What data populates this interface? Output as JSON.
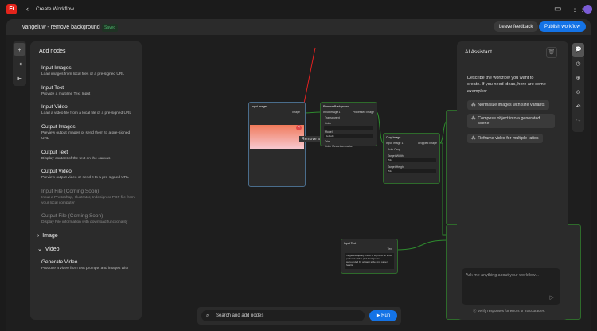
{
  "app": {
    "logo": "Fi",
    "back_title": "Create Workflow"
  },
  "header": {
    "workflow_name": "vangeluw - remove background",
    "status": "Saved",
    "feedback": "Leave feedback",
    "publish": "Publish workflow"
  },
  "panel": {
    "title": "Add nodes",
    "items": [
      {
        "name": "Input Images",
        "desc": "Load images from local files or a pre-signed URL"
      },
      {
        "name": "Input Text",
        "desc": "Provide a multiline Text Input"
      },
      {
        "name": "Input Video",
        "desc": "Load a video file from a local file or a pre-signed URL"
      },
      {
        "name": "Output Images",
        "desc": "Preview output images or send them to a pre-signed URL"
      },
      {
        "name": "Output Text",
        "desc": "Display content of the text on the canvas"
      },
      {
        "name": "Output Video",
        "desc": "Preview output video or send it to a pre-signed URL"
      },
      {
        "name": "Input File (Coming Soon)",
        "desc": "Input a Photoshop, Illustrator, Indesign or PDF file from your local computer"
      },
      {
        "name": "Output File (Coming Soon)",
        "desc": "Display File information with download functionality"
      }
    ],
    "sections": [
      "Image",
      "Video"
    ],
    "video_item": {
      "name": "Generate Video",
      "desc": "Produce a video from text prompts and images with"
    }
  },
  "nodes": {
    "input_images": {
      "title": "Input Images",
      "port": "Image",
      "tooltip": "Remove all images"
    },
    "remove_bg": {
      "title": "Remove Background",
      "in": "Input Image 1",
      "out": "Processed Image",
      "transparent": "Transparent",
      "color_label": "Color",
      "model_label": "Model",
      "model": "Default",
      "trim": "Trim",
      "decon": "Color Decontamination"
    },
    "crop": {
      "title": "Crop Image",
      "in": "Input Image 1",
      "out": "Cropped Image",
      "auto": "Auto Crop",
      "w_label": "Target Width",
      "w": "512",
      "h_label": "Target Height",
      "h": "512"
    },
    "input_text": {
      "title": "Input Text",
      "port": "Text",
      "text": "magazine quality photo of a phone on a red pedestal with a pink background surrounded by origami style pink paper hearts"
    }
  },
  "ai": {
    "title": "AI Assistant",
    "desc": "Describe the workflow you want to create. If you need ideas, here are some examples:",
    "suggestions": [
      "Normalize images with size variants",
      "Compose object into a generated scene",
      "Reframe video for multiple ratios"
    ],
    "placeholder": "Ask me anything about your workflow...",
    "verify": "Verify responses for errors or inaccuracies."
  },
  "bottom": {
    "search": "Search and add nodes",
    "run": "Run"
  }
}
